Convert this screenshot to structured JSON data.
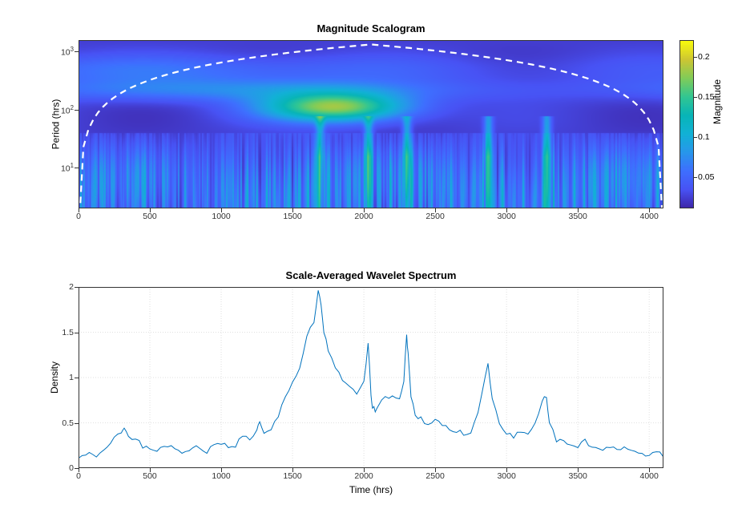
{
  "top": {
    "title": "Magnitude Scalogram",
    "ylabel": "Period (hrs)",
    "x_ticks": [
      0,
      500,
      1000,
      1500,
      2000,
      2500,
      3000,
      3500,
      4000
    ],
    "y_ticks": [
      10,
      100,
      1000
    ],
    "y_tick_labels": [
      "10¹",
      "10²",
      "10³"
    ],
    "xlim": [
      0,
      4100
    ],
    "ylim_log": [
      0.3,
      3.2
    ]
  },
  "colorbar": {
    "label": "Magnitude",
    "ticks": [
      0.05,
      0.1,
      0.15,
      0.2
    ],
    "range": [
      0.01,
      0.22
    ]
  },
  "bottom": {
    "title": "Scale-Averaged Wavelet Spectrum",
    "ylabel": "Density",
    "xlabel": "Time (hrs)",
    "x_ticks": [
      0,
      500,
      1000,
      1500,
      2000,
      2500,
      3000,
      3500,
      4000
    ],
    "y_ticks": [
      0,
      0.5,
      1,
      1.5,
      2
    ],
    "xlim": [
      0,
      4100
    ],
    "ylim": [
      0,
      2
    ]
  },
  "chart_data": [
    {
      "type": "heatmap",
      "title": "Magnitude Scalogram",
      "xlabel": "",
      "ylabel": "Period (hrs)",
      "xlim": [
        0,
        4100
      ],
      "ylim": [
        2,
        1500
      ],
      "yscale": "log",
      "colorbar_label": "Magnitude",
      "color_range": [
        0.01,
        0.22
      ],
      "note": "Continuous wavelet transform scalogram; high-magnitude region (~0.2) centered roughly Period≈120 hrs, Time≈1700-2000 hrs; dashed white cone-of-influence boundary."
    },
    {
      "type": "line",
      "title": "Scale-Averaged Wavelet Spectrum",
      "xlabel": "Time (hrs)",
      "ylabel": "Density",
      "xlim": [
        0,
        4100
      ],
      "ylim": [
        0,
        2
      ],
      "x": [
        0,
        50,
        100,
        150,
        200,
        250,
        300,
        320,
        350,
        400,
        450,
        500,
        550,
        600,
        650,
        700,
        750,
        800,
        850,
        900,
        950,
        1000,
        1050,
        1100,
        1150,
        1200,
        1250,
        1270,
        1300,
        1350,
        1400,
        1450,
        1500,
        1550,
        1600,
        1650,
        1680,
        1700,
        1720,
        1750,
        1800,
        1850,
        1900,
        1950,
        2000,
        2030,
        2050,
        2060,
        2080,
        2100,
        2150,
        2200,
        2250,
        2280,
        2300,
        2310,
        2330,
        2360,
        2400,
        2450,
        2500,
        2550,
        2600,
        2650,
        2700,
        2750,
        2800,
        2850,
        2870,
        2900,
        2950,
        3000,
        3050,
        3100,
        3150,
        3200,
        3250,
        3280,
        3300,
        3350,
        3400,
        3450,
        3500,
        3550,
        3600,
        3650,
        3700,
        3750,
        3800,
        3850,
        3900,
        3950,
        4000,
        4050,
        4100
      ],
      "values": [
        0.12,
        0.15,
        0.14,
        0.15,
        0.22,
        0.33,
        0.4,
        0.45,
        0.37,
        0.32,
        0.23,
        0.2,
        0.2,
        0.22,
        0.25,
        0.2,
        0.17,
        0.23,
        0.21,
        0.18,
        0.25,
        0.27,
        0.24,
        0.25,
        0.35,
        0.32,
        0.42,
        0.5,
        0.37,
        0.42,
        0.57,
        0.8,
        0.95,
        1.1,
        1.45,
        1.6,
        1.95,
        1.8,
        1.5,
        1.3,
        1.12,
        0.95,
        0.9,
        0.8,
        0.95,
        1.37,
        0.82,
        0.68,
        0.63,
        0.7,
        0.8,
        0.8,
        0.78,
        0.95,
        1.47,
        1.27,
        0.78,
        0.6,
        0.55,
        0.48,
        0.55,
        0.48,
        0.42,
        0.4,
        0.38,
        0.4,
        0.6,
        1.0,
        1.15,
        0.75,
        0.5,
        0.38,
        0.35,
        0.4,
        0.37,
        0.5,
        0.75,
        0.77,
        0.5,
        0.3,
        0.32,
        0.25,
        0.22,
        0.3,
        0.25,
        0.2,
        0.22,
        0.25,
        0.22,
        0.2,
        0.2,
        0.15,
        0.15,
        0.18,
        0.13
      ]
    }
  ]
}
